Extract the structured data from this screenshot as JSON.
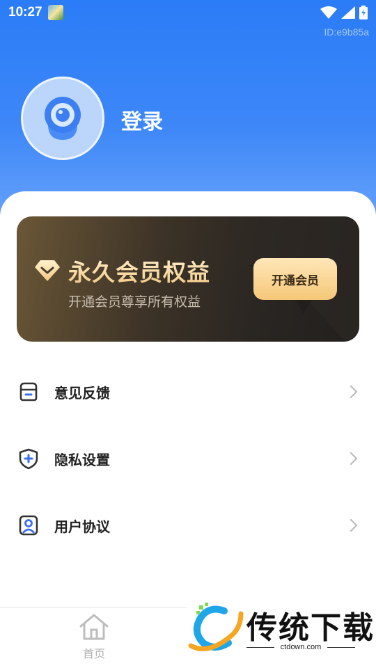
{
  "status_bar": {
    "time": "10:27"
  },
  "device_id": "ID:e9b85a",
  "profile": {
    "login_label": "登录"
  },
  "vip_card": {
    "title": "永久会员权益",
    "subtitle": "开通会员尊享所有权益",
    "button_label": "开通会员"
  },
  "menu": {
    "items": [
      {
        "label": "意见反馈",
        "icon": "feedback-icon"
      },
      {
        "label": "隐私设置",
        "icon": "shield-plus-icon"
      },
      {
        "label": "用户协议",
        "icon": "user-badge-icon"
      }
    ]
  },
  "bottom_nav": {
    "home_label": "首页"
  },
  "watermark": {
    "brand": "传统下载",
    "domain": "ctdown.com"
  },
  "colors": {
    "header_blue": "#2b7cf7",
    "vip_gold": "#f5c778",
    "vip_dark": "#2a2622"
  }
}
